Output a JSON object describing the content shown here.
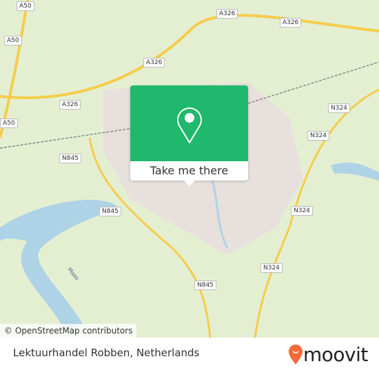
{
  "map": {
    "road_labels": [
      {
        "id": "a50-1",
        "text": "A50"
      },
      {
        "id": "a50-2",
        "text": "A50"
      },
      {
        "id": "a50-3",
        "text": "A50"
      },
      {
        "id": "a326-1",
        "text": "A326"
      },
      {
        "id": "a326-2",
        "text": "A326"
      },
      {
        "id": "a326-3",
        "text": "A326"
      },
      {
        "id": "a326-4",
        "text": "A326"
      },
      {
        "id": "n324-1",
        "text": "N324"
      },
      {
        "id": "n324-2",
        "text": "N324"
      },
      {
        "id": "n324-3",
        "text": "N324"
      },
      {
        "id": "n324-4",
        "text": "N324"
      },
      {
        "id": "n845-1",
        "text": "N845"
      },
      {
        "id": "n845-2",
        "text": "N845"
      },
      {
        "id": "n845-3",
        "text": "N845"
      }
    ],
    "river_label": "Maas",
    "attribution": "© OpenStreetMap contributors",
    "colors": {
      "land": "#e4efd2",
      "water": "#aed3e6",
      "motorway": "#f5cc4a",
      "urban": "#e8e0dc"
    }
  },
  "popup": {
    "icon": "map-pin-icon",
    "button_label": "Take me there",
    "color": "#1fb86c"
  },
  "footer": {
    "place_name": "Lektuurhandel Robben, Netherlands",
    "brand": "moovit",
    "brand_color": "#f26b3a"
  }
}
